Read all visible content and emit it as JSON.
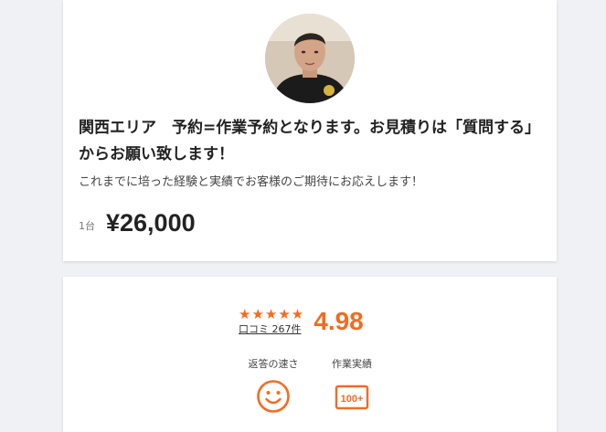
{
  "listing": {
    "title": "関西エリア　予約=作業予約となります。お見積りは「質問する」からお願い致します！",
    "description": "これまでに培った経験と実績でお客様のご期待にお応えします！",
    "price_unit": "1台",
    "price": "¥26,000"
  },
  "rating": {
    "stars_display": "★★★★★",
    "stars_count": 5,
    "reviews_label": "口コミ 267件",
    "score": "4.98"
  },
  "metrics": [
    {
      "label": "返答の速さ",
      "icon": "smiley-icon"
    },
    {
      "label": "作業実績",
      "icon": "badge-100plus-icon",
      "badge_text": "100+"
    }
  ],
  "colors": {
    "accent": "#f26b21",
    "background": "#f0f1f4",
    "card": "#ffffff"
  }
}
